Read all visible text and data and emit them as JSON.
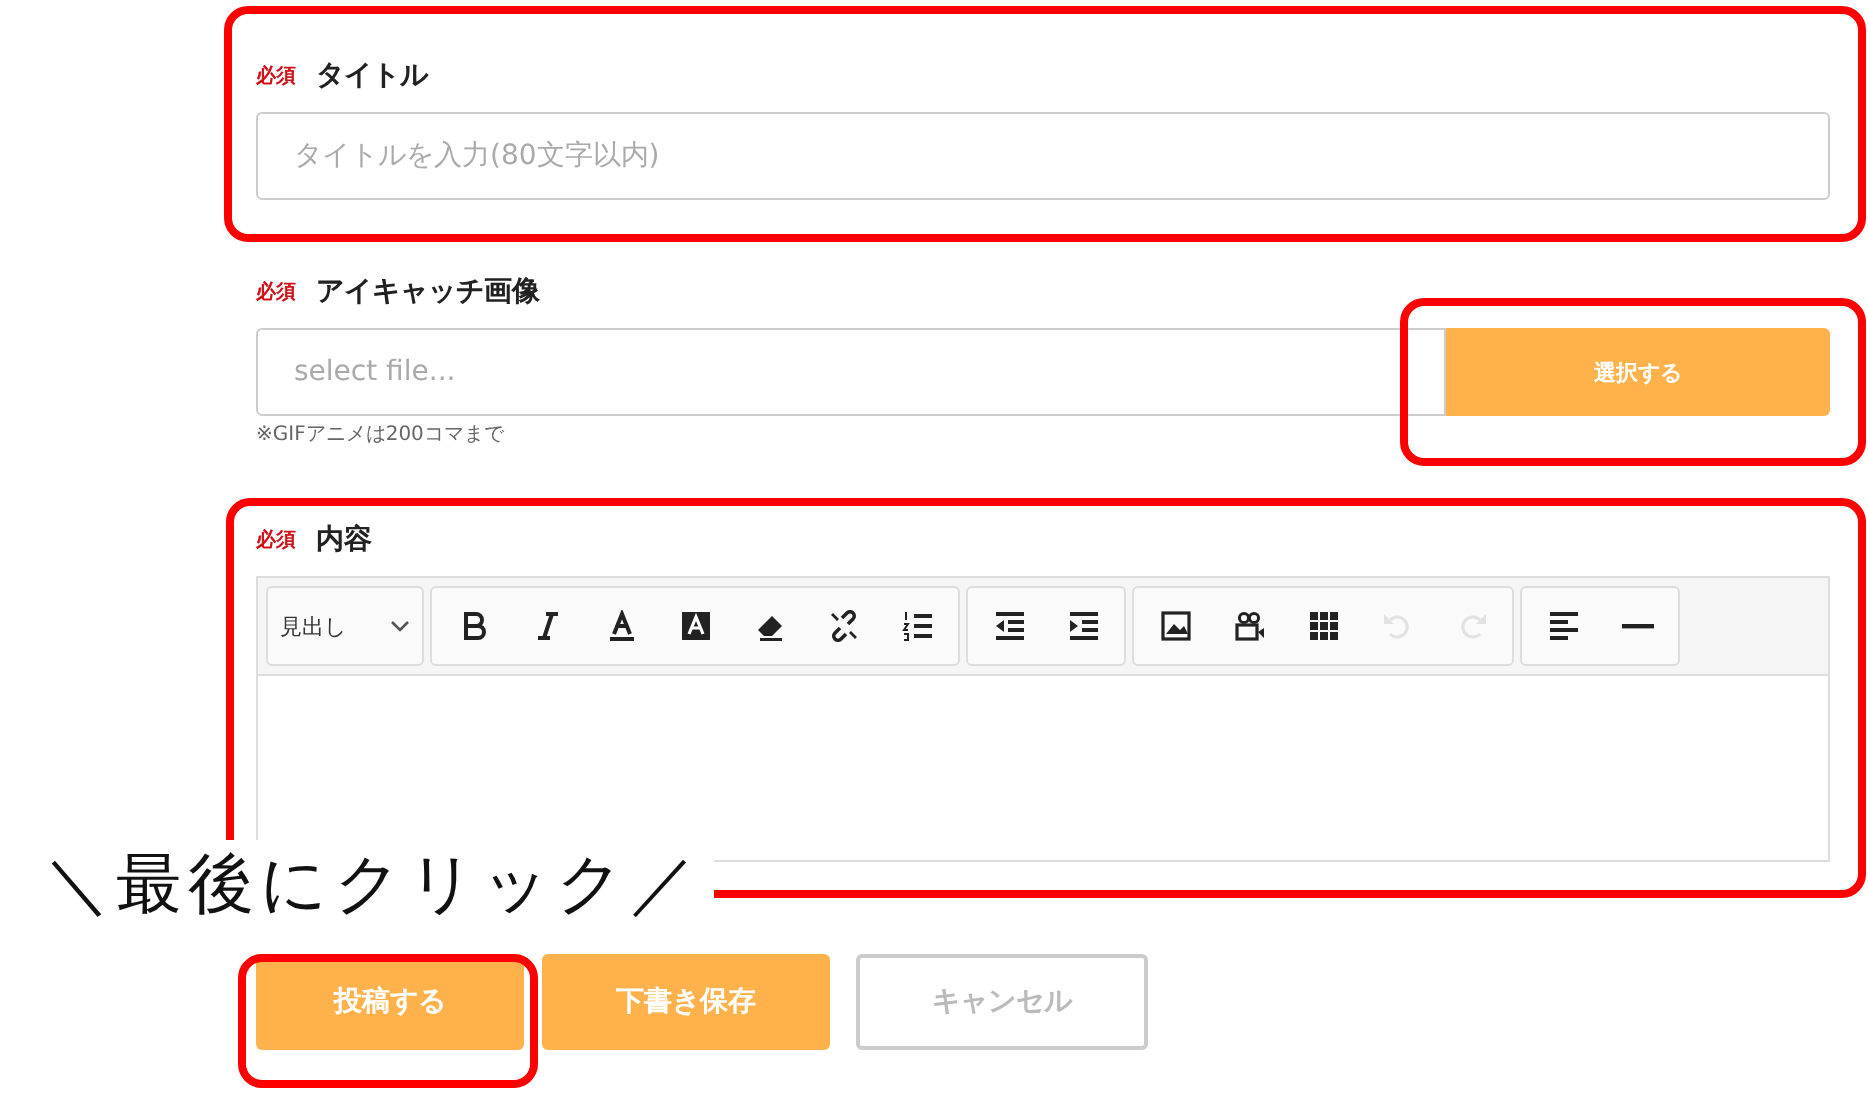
{
  "fields": [
    {
      "kind": "text",
      "required_badge": "必須",
      "label": "タイトル",
      "placeholder": "タイトルを入力(80文字以内)"
    },
    {
      "kind": "file",
      "required_badge": "必須",
      "label": "アイキャッチ画像",
      "placeholder": "select file...",
      "button": "選択する",
      "note": "※GIFアニメは200コマまで"
    },
    {
      "kind": "editor",
      "required_badge": "必須",
      "label": "内容",
      "heading_select": "見出し",
      "toolbar": [
        [
          {
            "kind": "bold",
            "disabled": false
          },
          {
            "kind": "italic",
            "disabled": false
          },
          {
            "kind": "underline",
            "disabled": false
          },
          {
            "kind": "highlight",
            "disabled": false
          },
          {
            "kind": "eraser",
            "disabled": false
          },
          {
            "kind": "unlink",
            "disabled": false
          },
          {
            "kind": "ordered-list",
            "disabled": false
          }
        ],
        [
          {
            "kind": "outdent",
            "disabled": false
          },
          {
            "kind": "indent",
            "disabled": false
          }
        ],
        [
          {
            "kind": "image",
            "disabled": false
          },
          {
            "kind": "video",
            "disabled": false
          },
          {
            "kind": "table",
            "disabled": false
          },
          {
            "kind": "undo",
            "disabled": true
          },
          {
            "kind": "redo",
            "disabled": true
          }
        ],
        [
          {
            "kind": "align-left",
            "disabled": false
          },
          {
            "kind": "rule",
            "disabled": false
          }
        ]
      ]
    }
  ],
  "callout": "＼最後にクリック／",
  "buttons": [
    {
      "label": "投稿する",
      "kind": "primary"
    },
    {
      "label": "下書き保存",
      "kind": "primary"
    },
    {
      "label": "キャンセル",
      "kind": "secondary"
    }
  ]
}
